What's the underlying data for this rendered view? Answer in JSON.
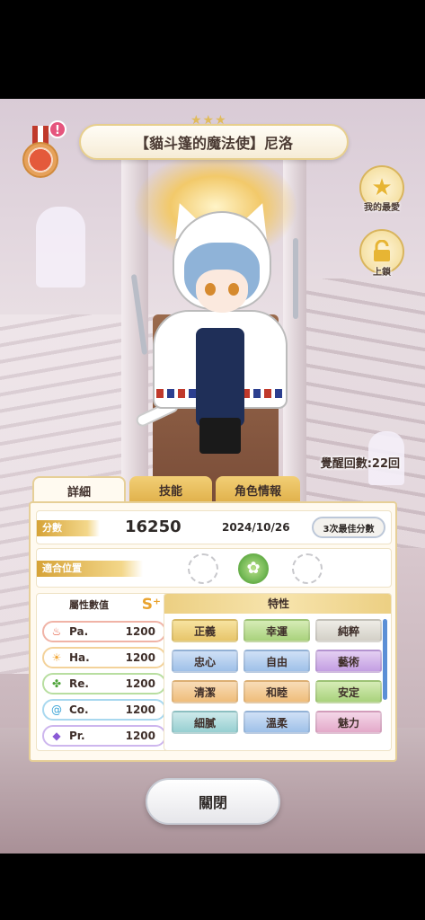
{
  "title": {
    "stars": "★★★",
    "card_name": "【貓斗篷的魔法使】尼洛"
  },
  "alert_badge": "!",
  "side_buttons": {
    "favorite_label": "我的最愛",
    "lock_label": "上鎖"
  },
  "awaken": {
    "text": "覺醒回數:22回"
  },
  "tabs": [
    {
      "label": "詳細"
    },
    {
      "label": "技能"
    },
    {
      "label": "角色情報"
    }
  ],
  "score": {
    "label": "分數",
    "value": "16250",
    "date": "2024/10/26",
    "best_button": "3次最佳分數"
  },
  "position": {
    "label": "適合位置",
    "active_icon": "✿"
  },
  "attributes": {
    "header": "屬性數值",
    "rank": "S⁺",
    "items": [
      {
        "name": "Pa.",
        "value": "1200",
        "icon": "flame-icon",
        "color": "#e4573b"
      },
      {
        "name": "Ha.",
        "value": "1200",
        "icon": "sun-icon",
        "color": "#f1a83b"
      },
      {
        "name": "Re.",
        "value": "1200",
        "icon": "clover-icon",
        "color": "#4fa43a"
      },
      {
        "name": "Co.",
        "value": "1200",
        "icon": "swirl-icon",
        "color": "#3aa3d6"
      },
      {
        "name": "Pr.",
        "value": "1200",
        "icon": "diamond-icon",
        "color": "#8a5ad6"
      }
    ]
  },
  "traits": {
    "header": "特性",
    "items": [
      {
        "label": "正義",
        "style": "t-gold"
      },
      {
        "label": "幸運",
        "style": "t-green"
      },
      {
        "label": "純粹",
        "style": "t-grey"
      },
      {
        "label": "忠心",
        "style": "t-blue"
      },
      {
        "label": "自由",
        "style": "t-blue"
      },
      {
        "label": "藝術",
        "style": "t-purple"
      },
      {
        "label": "清潔",
        "style": "t-orange"
      },
      {
        "label": "和睦",
        "style": "t-orange"
      },
      {
        "label": "安定",
        "style": "t-green"
      },
      {
        "label": "細膩",
        "style": "t-teal"
      },
      {
        "label": "溫柔",
        "style": "t-blue"
      },
      {
        "label": "魅力",
        "style": "t-pink"
      }
    ]
  },
  "close_button": "關閉"
}
